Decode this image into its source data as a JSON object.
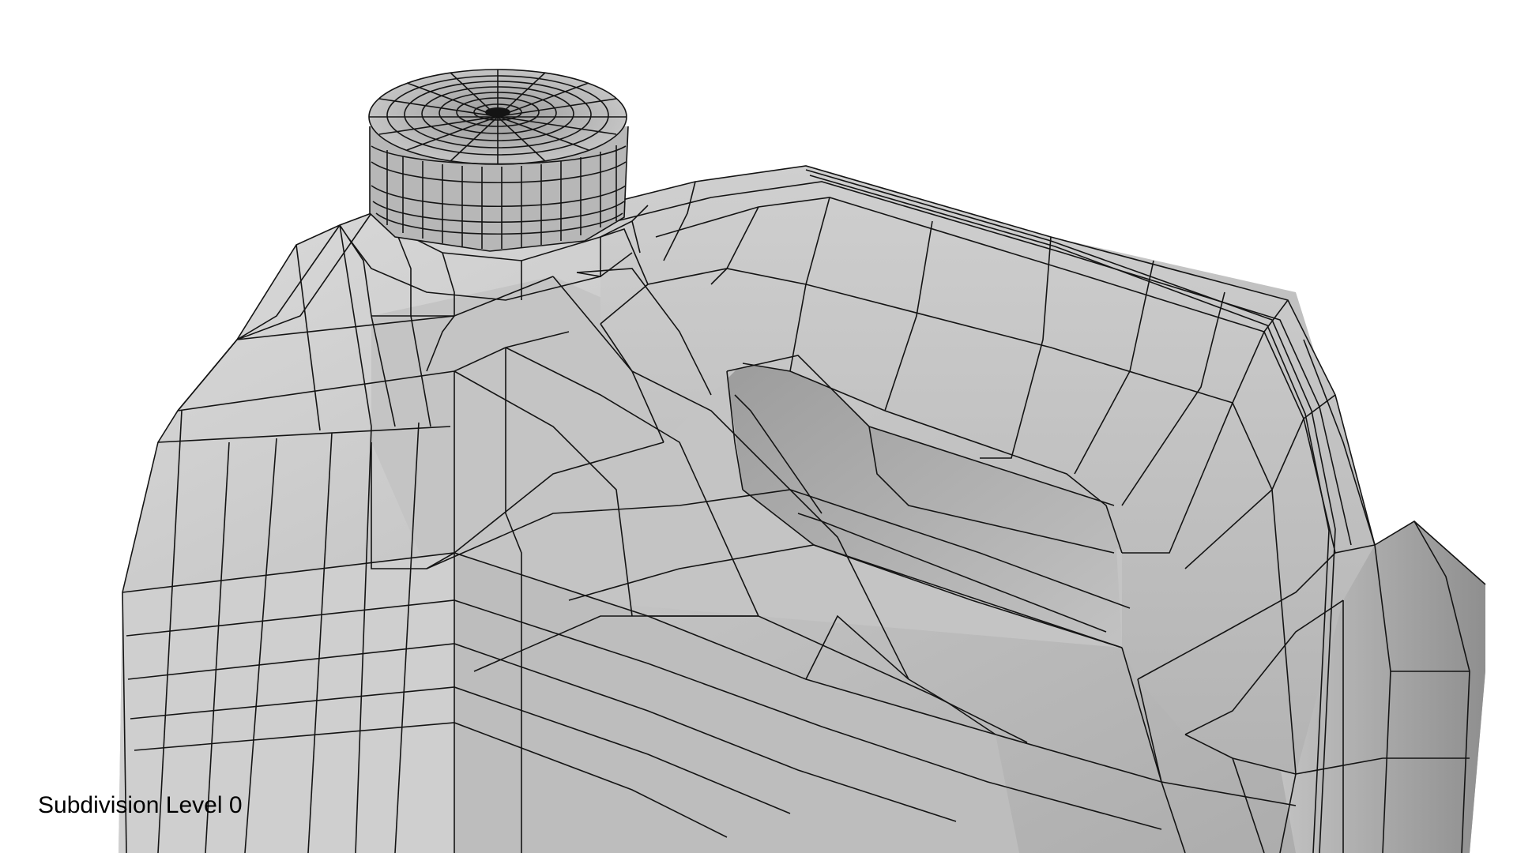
{
  "viewport": {
    "caption": "Subdivision Level 0"
  },
  "scene": {
    "subject": "jerrycan-mesh-wireframe",
    "colors": {
      "background": "#ffffff",
      "surface_light": "#d2d2d2",
      "surface_mid": "#b4b4b4",
      "surface_dark": "#8e8e8e",
      "wire": "#141414"
    }
  }
}
